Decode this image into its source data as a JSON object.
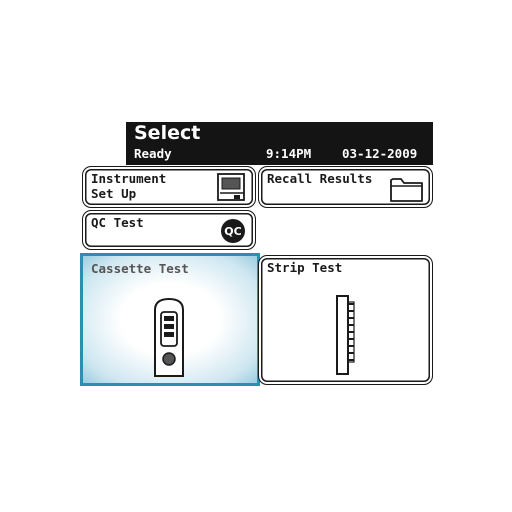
{
  "header": {
    "title": "Select",
    "status": "Ready",
    "time": "9:14PM",
    "date": "03-12-2009"
  },
  "buttons": {
    "instrument_setup": "Instrument\nSet Up",
    "recall_results": "Recall Results",
    "qc_test": "QC Test",
    "qc_icon_text": "QC",
    "cassette_test": "Cassette Test",
    "strip_test": "Strip Test"
  },
  "colors": {
    "selection": "#2a8fb0",
    "header_bg": "#141414"
  },
  "icons": [
    "monitor-icon",
    "folder-icon",
    "qc-icon",
    "cassette-icon",
    "strip-icon"
  ]
}
